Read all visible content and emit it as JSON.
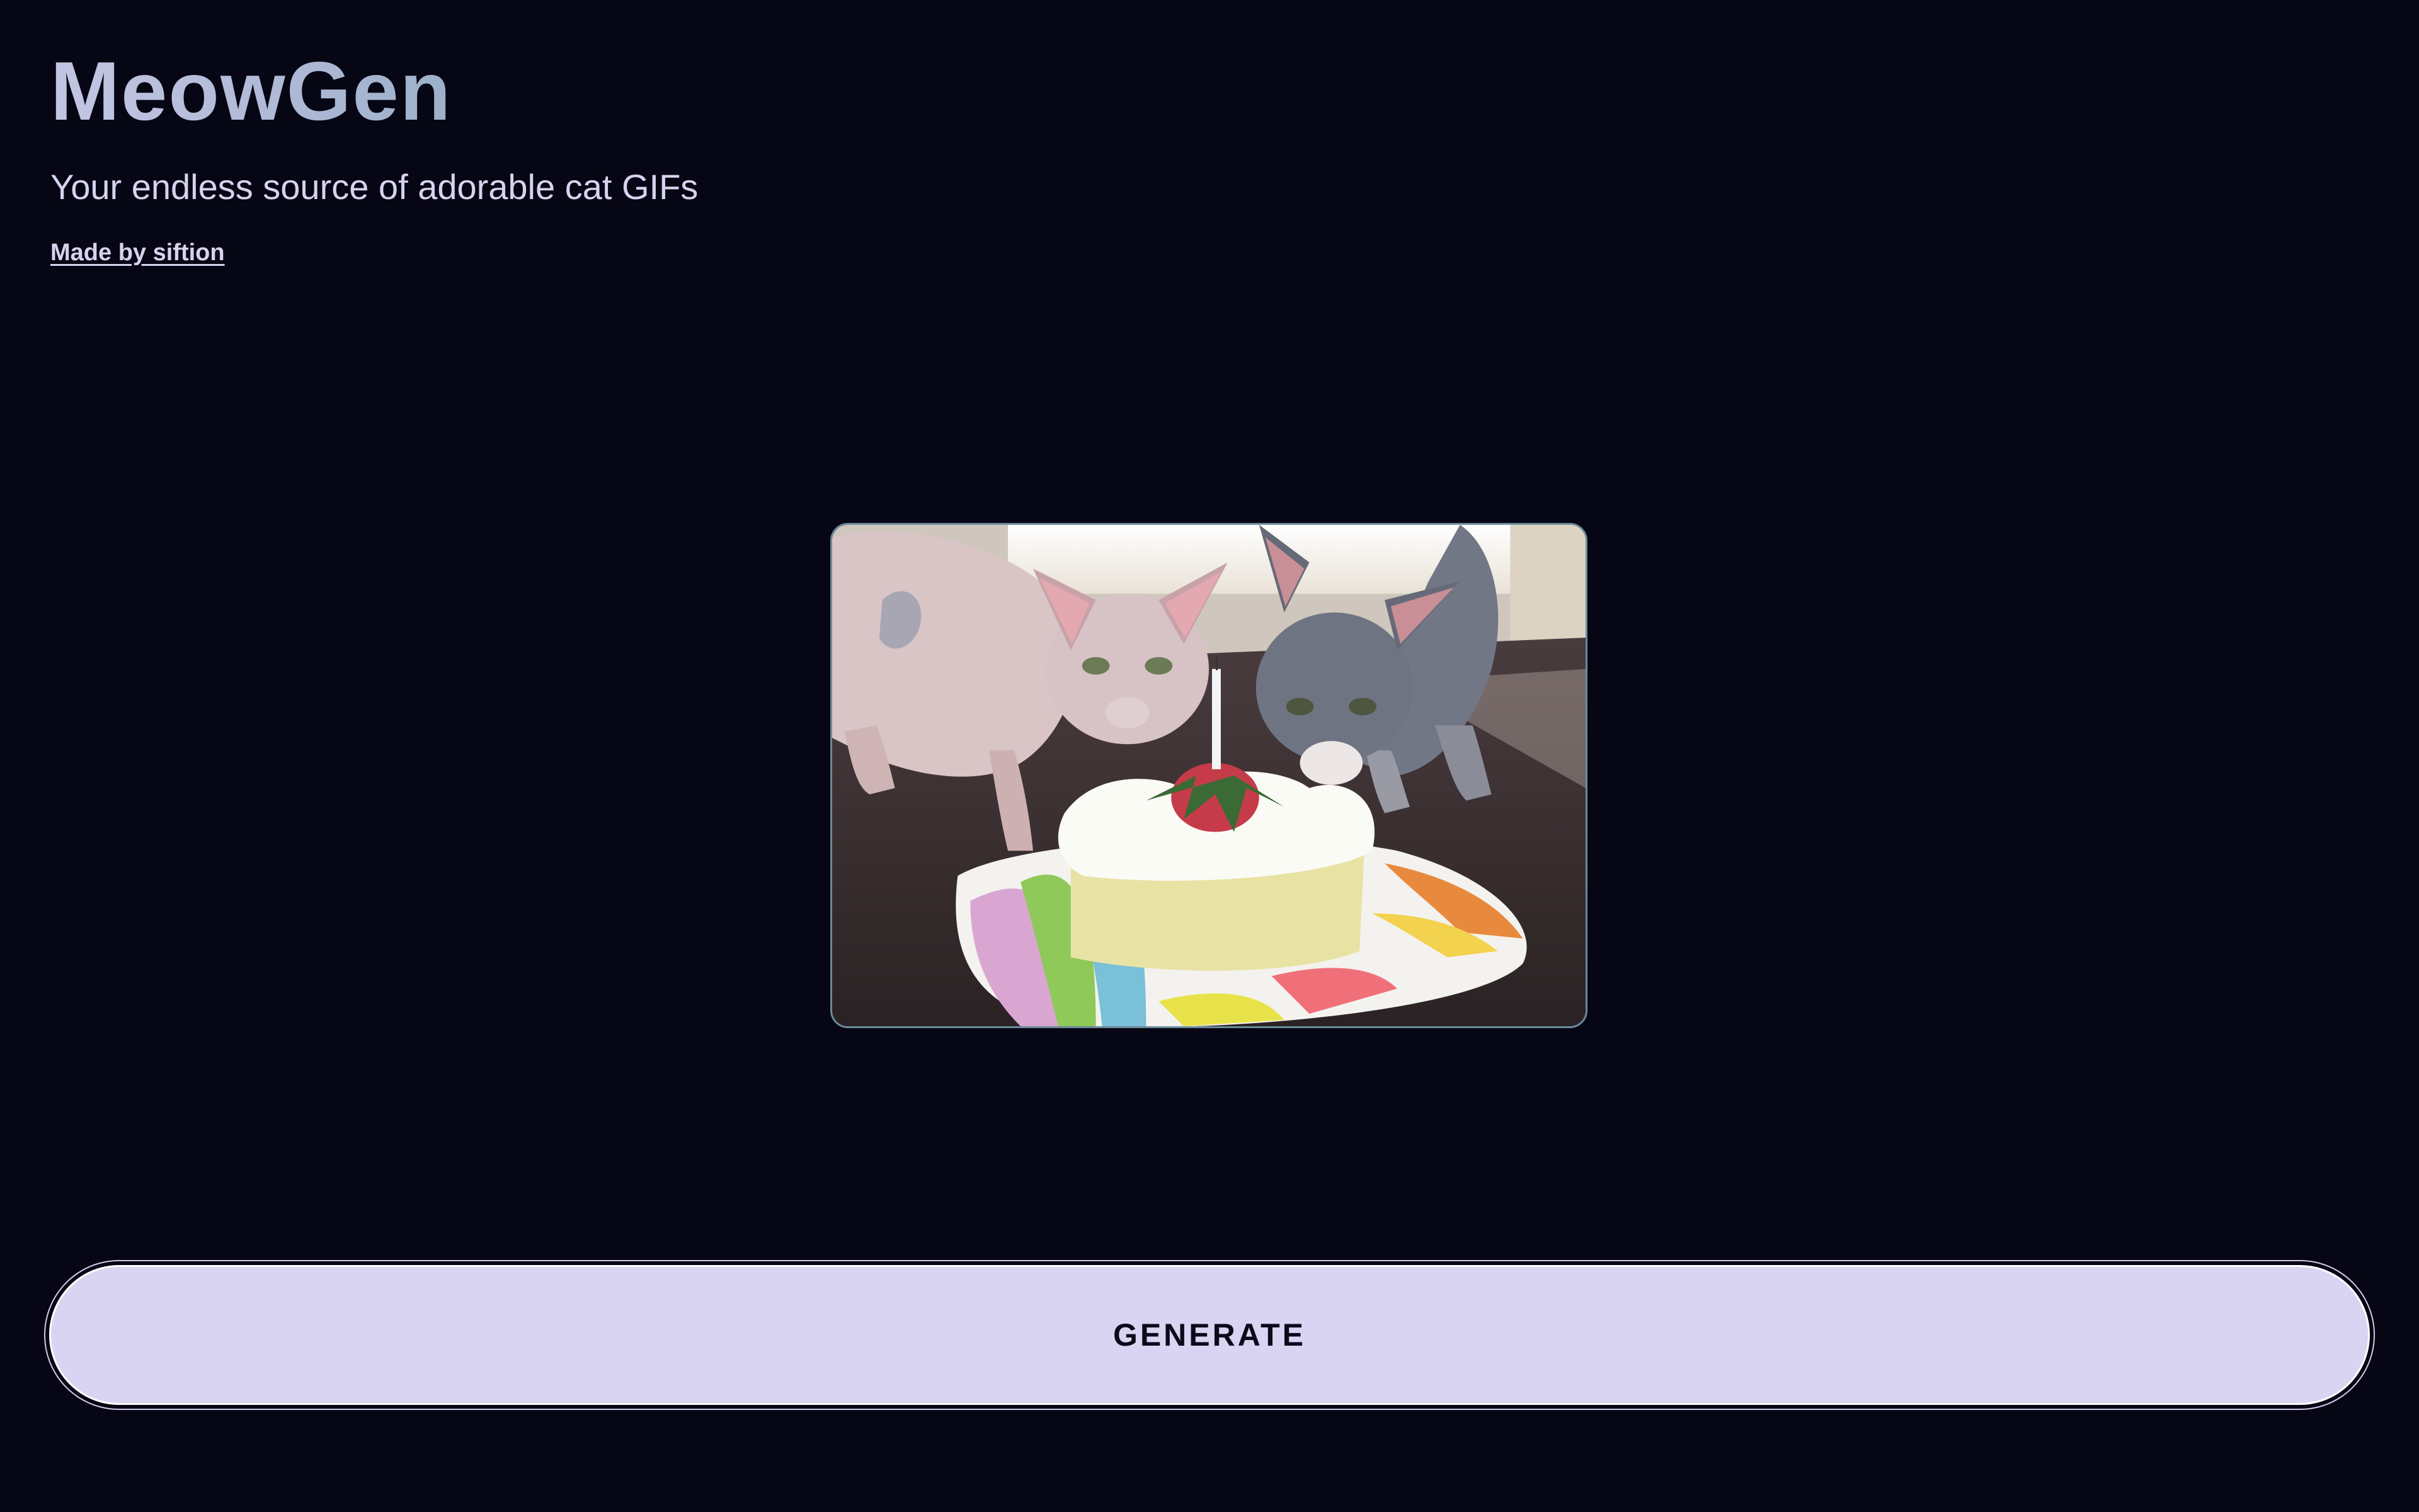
{
  "app": {
    "title": "MeowGen",
    "subtitle": "Your endless source of adorable cat GIFs",
    "credit_link": "Made by siftion"
  },
  "main": {
    "gif_alt": "Two hairless cats sniffing a slice of cake with a strawberry and a candle on a striped plate"
  },
  "actions": {
    "generate_label": "GENERATE"
  },
  "colors": {
    "background": "#070614",
    "button": "#d8d4f1",
    "title_gradient_start": "#c3c6e2",
    "title_gradient_end": "#7ea3b2"
  }
}
